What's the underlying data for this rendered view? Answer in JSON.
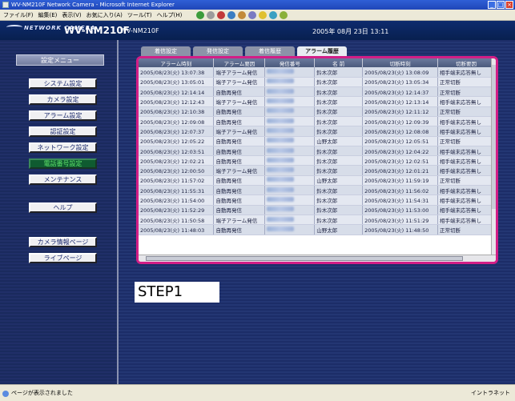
{
  "window": {
    "title": "WV-NM210F Network Camera - Microsoft Internet Explorer",
    "buttons": [
      "_",
      "□",
      "×"
    ]
  },
  "menubar": {
    "items": [
      "ファイル(F)",
      "編集(E)",
      "表示(V)",
      "お気に入り(A)",
      "ツール(T)",
      "ヘルプ(H)"
    ]
  },
  "header": {
    "logo_text": "NETWORK CAMERA",
    "model": "WV-NM210F",
    "model_sub": "WV-NM210F",
    "datetime": "2005年 08月 23日 13:11"
  },
  "sidebar": {
    "menu_title": "設定メニュー",
    "buttons": [
      {
        "label": "システム設定"
      },
      {
        "label": "カメラ設定"
      },
      {
        "label": "アラーム設定"
      },
      {
        "label": "認証設定"
      },
      {
        "label": "ネットワーク設定"
      },
      {
        "label": "電話番号設定"
      },
      {
        "label": "メンテナンス"
      },
      {
        "label": "ヘルプ"
      },
      {
        "label": "カメラ情報ページ"
      },
      {
        "label": "ライブページ"
      }
    ]
  },
  "tabs": [
    "着信設定",
    "発信設定",
    "着信履歴",
    "アラーム履歴"
  ],
  "table": {
    "columns": [
      "アラーム時刻",
      "アラーム要因",
      "発信番号",
      "名 前",
      "切断時刻",
      "切断要因"
    ],
    "rows": [
      [
        "2005/08/23(火) 13:07:38",
        "端子アラーム発信",
        "鈴木次郎",
        "2005/08/23(火) 13:08:09",
        "相手端末応答無し"
      ],
      [
        "2005/08/23(火) 13:05:01",
        "端子アラーム発信",
        "鈴木次郎",
        "2005/08/23(火) 13:05:34",
        "正常切断"
      ],
      [
        "2005/08/23(火) 12:14:14",
        "自動再発信",
        "鈴木次郎",
        "2005/08/23(火) 12:14:37",
        "正常切断"
      ],
      [
        "2005/08/23(火) 12:12:43",
        "端子アラーム発信",
        "鈴木次郎",
        "2005/08/23(火) 12:13:14",
        "相手端末応答無し"
      ],
      [
        "2005/08/23(火) 12:10:38",
        "自動再発信",
        "鈴木次郎",
        "2005/08/23(火) 12:11:12",
        "正常切断"
      ],
      [
        "2005/08/23(火) 12:09:08",
        "自動再発信",
        "鈴木次郎",
        "2005/08/23(火) 12:09:39",
        "相手端末応答無し"
      ],
      [
        "2005/08/23(火) 12:07:37",
        "端子アラーム発信",
        "鈴木次郎",
        "2005/08/23(火) 12:08:08",
        "相手端末応答無し"
      ],
      [
        "2005/08/23(火) 12:05:22",
        "自動再発信",
        "山野太郎",
        "2005/08/23(火) 12:05:51",
        "正常切断"
      ],
      [
        "2005/08/23(火) 12:03:51",
        "自動再発信",
        "鈴木次郎",
        "2005/08/23(火) 12:04:22",
        "相手端末応答無し"
      ],
      [
        "2005/08/23(火) 12:02:21",
        "自動再発信",
        "鈴木次郎",
        "2005/08/23(火) 12:02:51",
        "相手端末応答無し"
      ],
      [
        "2005/08/23(火) 12:00:50",
        "端子アラーム発信",
        "鈴木次郎",
        "2005/08/23(火) 12:01:21",
        "相手端末応答無し"
      ],
      [
        "2005/08/23(火) 11:57:02",
        "自動再発信",
        "山野太郎",
        "2005/08/23(火) 11:59:19",
        "正常切断"
      ],
      [
        "2005/08/23(火) 11:55:31",
        "自動再発信",
        "鈴木次郎",
        "2005/08/23(火) 11:56:02",
        "相手端末応答無し"
      ],
      [
        "2005/08/23(火) 11:54:00",
        "自動再発信",
        "鈴木次郎",
        "2005/08/23(火) 11:54:31",
        "相手端末応答無し"
      ],
      [
        "2005/08/23(火) 11:52:29",
        "自動再発信",
        "鈴木次郎",
        "2005/08/23(火) 11:53:00",
        "相手端末応答無し"
      ],
      [
        "2005/08/23(火) 11:50:58",
        "端子アラーム発信",
        "鈴木次郎",
        "2005/08/23(火) 11:51:29",
        "相手端末応答無し"
      ],
      [
        "2005/08/23(火) 11:48:03",
        "自動再発信",
        "山野太郎",
        "2005/08/23(火) 11:48:50",
        "正常切断"
      ]
    ]
  },
  "step_label": "STEP1",
  "statusbar": {
    "text": "ページが表示されました",
    "zone": "イントラネット"
  }
}
